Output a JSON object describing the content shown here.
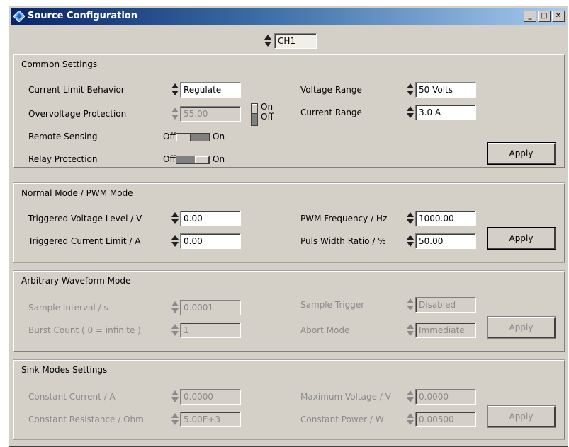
{
  "window": {
    "title": "Source Configuration"
  },
  "channel": {
    "value": "CH1"
  },
  "common": {
    "title": "Common Settings",
    "current_limit_label": "Current Limit Behavior",
    "current_limit_value": "Regulate",
    "ovp_label": "Overvoltage Protection",
    "ovp_value": "55.00",
    "ovp_on": "On",
    "ovp_off": "Off",
    "remote_label": "Remote Sensing",
    "remote_off": "Off",
    "remote_on": "On",
    "relay_label": "Relay Protection",
    "relay_off": "Off",
    "relay_on": "On",
    "voltage_range_label": "Voltage Range",
    "voltage_range_value": "50 Volts",
    "current_range_label": "Current Range",
    "current_range_value": "3.0  A",
    "apply": "Apply"
  },
  "normal": {
    "title": "Normal Mode / PWM Mode",
    "trig_voltage_label": "Triggered Voltage Level / V",
    "trig_voltage_value": "0.00",
    "trig_current_label": "Triggered Current Limit / A",
    "trig_current_value": "0.00",
    "pwm_freq_label": "PWM Frequency / Hz",
    "pwm_freq_value": "1000.00",
    "pulse_width_label": "Puls Width Ratio / %",
    "pulse_width_value": "50.00",
    "apply": "Apply"
  },
  "arb": {
    "title": "Arbitrary Waveform Mode",
    "sample_interval_label": "Sample Interval / s",
    "sample_interval_value": "0.0001",
    "burst_count_label": "Burst Count ( 0 = infinite )",
    "burst_count_value": "1",
    "sample_trigger_label": "Sample Trigger",
    "sample_trigger_value": "Disabled",
    "abort_mode_label": "Abort Mode",
    "abort_mode_value": "Immediate",
    "apply": "Apply"
  },
  "sink": {
    "title": "Sink Modes Settings",
    "const_current_label": "Constant Current / A",
    "const_current_value": "0.0000",
    "const_resistance_label": "Constant Resistance / Ohm",
    "const_resistance_value": "5.00E+3",
    "max_voltage_label": "Maximum Voltage / V",
    "max_voltage_value": "0.0000",
    "const_power_label": "Constant Power / W",
    "const_power_value": "0.00500",
    "apply": "Apply"
  }
}
